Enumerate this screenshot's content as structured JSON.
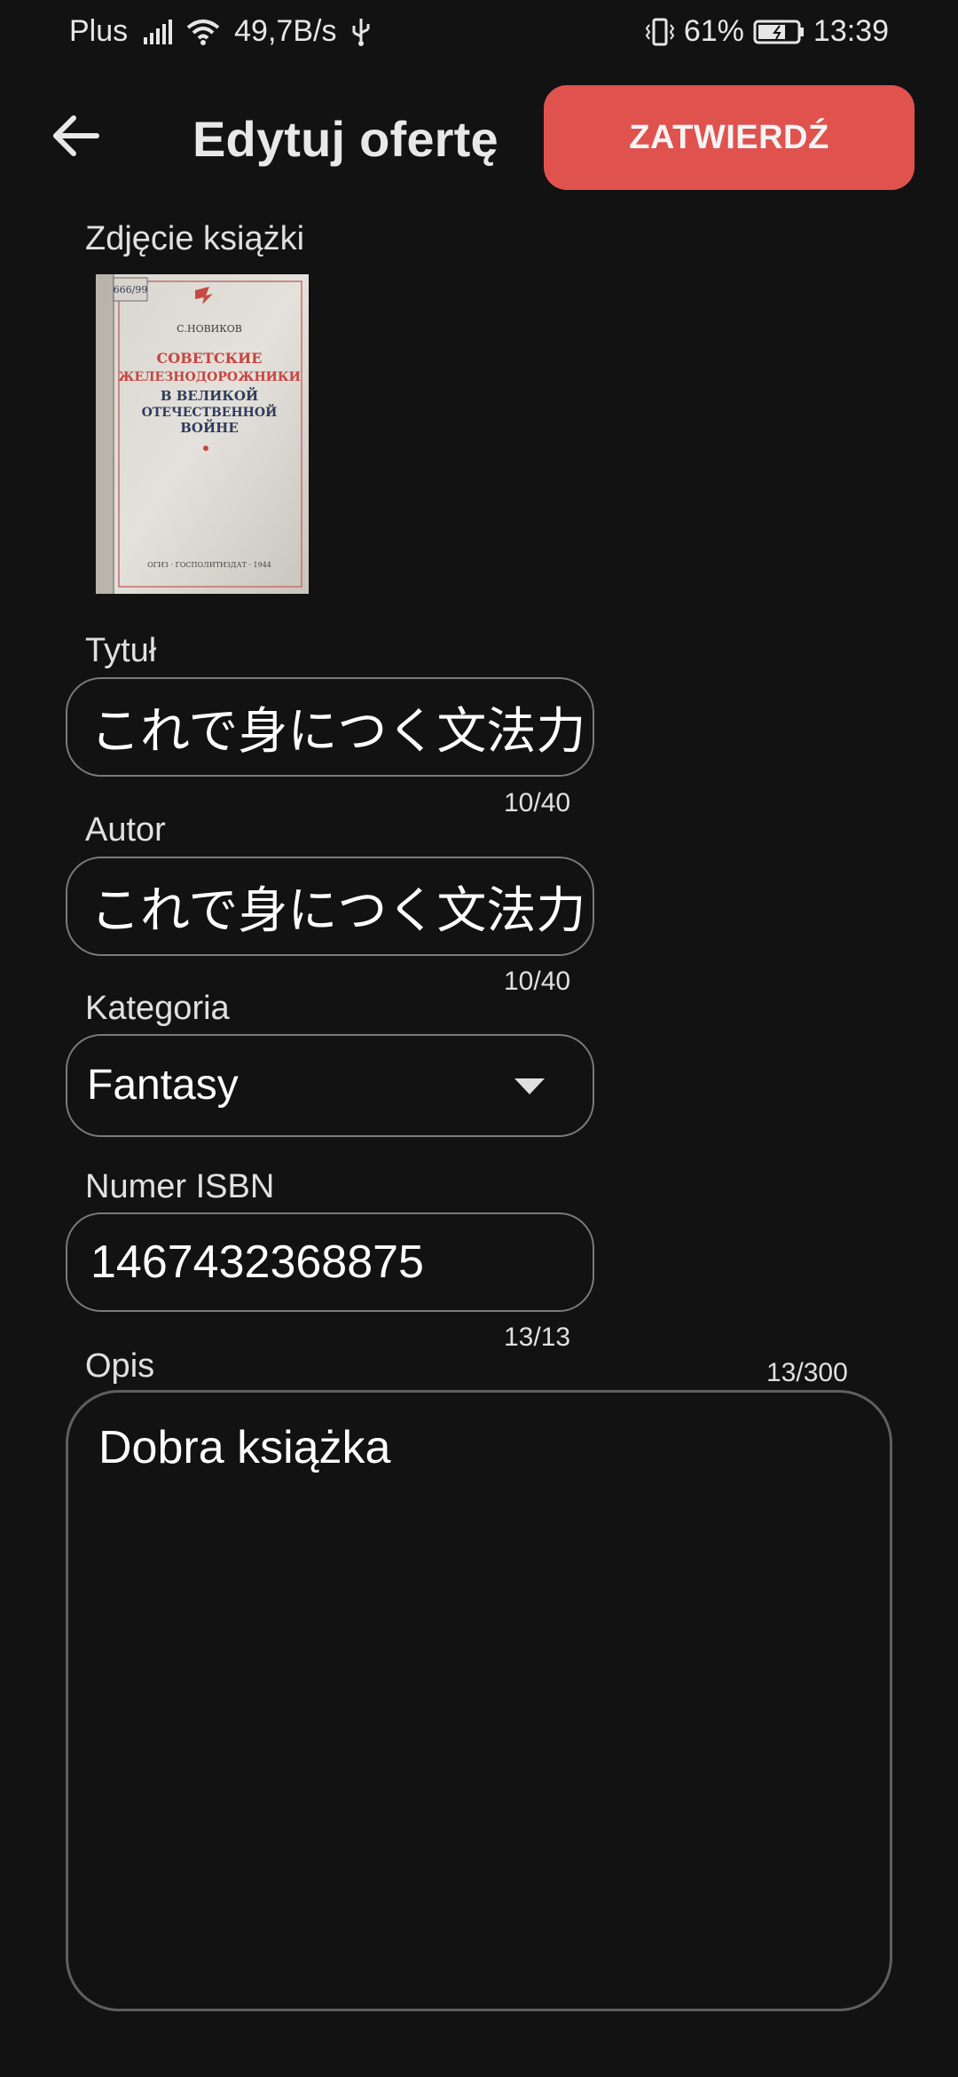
{
  "status_bar": {
    "carrier": "Plus",
    "net_speed": "49,7B/s",
    "battery": "61%",
    "time": "13:39",
    "icons": [
      "signal-icon",
      "wifi-icon",
      "usb-icon",
      "vibrate-icon",
      "battery-icon"
    ]
  },
  "header": {
    "title": "Edytuj ofertę",
    "confirm_label": "ZATWIERDŹ",
    "back_icon": "arrow-left-icon"
  },
  "photo": {
    "label": "Zdjęcie książki",
    "cover": {
      "author": "С.НОВИКОВ",
      "title_red_1": "СОВЕТСКИЕ",
      "title_red_2": "ЖЕЛЕЗНОДОРОЖНИКИ",
      "title_dark_1": "В ВЕЛИКОЙ",
      "title_dark_2": "ОТЕЧЕСТВЕННОЙ",
      "title_dark_3": "ВОЙНЕ",
      "publisher": "ОГИЗ · ГОСПОЛИТИЗДАТ · 1944",
      "stamp": "666/99"
    }
  },
  "fields": {
    "title": {
      "label": "Tytuł",
      "value": "これで身につく文法力",
      "counter": "10/40"
    },
    "author": {
      "label": "Autor",
      "value": "これで身につく文法力",
      "counter": "10/40"
    },
    "category": {
      "label": "Kategoria",
      "value": "Fantasy"
    },
    "isbn": {
      "label": "Numer ISBN",
      "value": "1467432368875",
      "counter": "13/13"
    },
    "description": {
      "label": "Opis",
      "value": "Dobra książka",
      "counter": "13/300"
    }
  },
  "colors": {
    "background": "#121212",
    "accent": "#e0524e",
    "border": "#7b7b7b"
  }
}
